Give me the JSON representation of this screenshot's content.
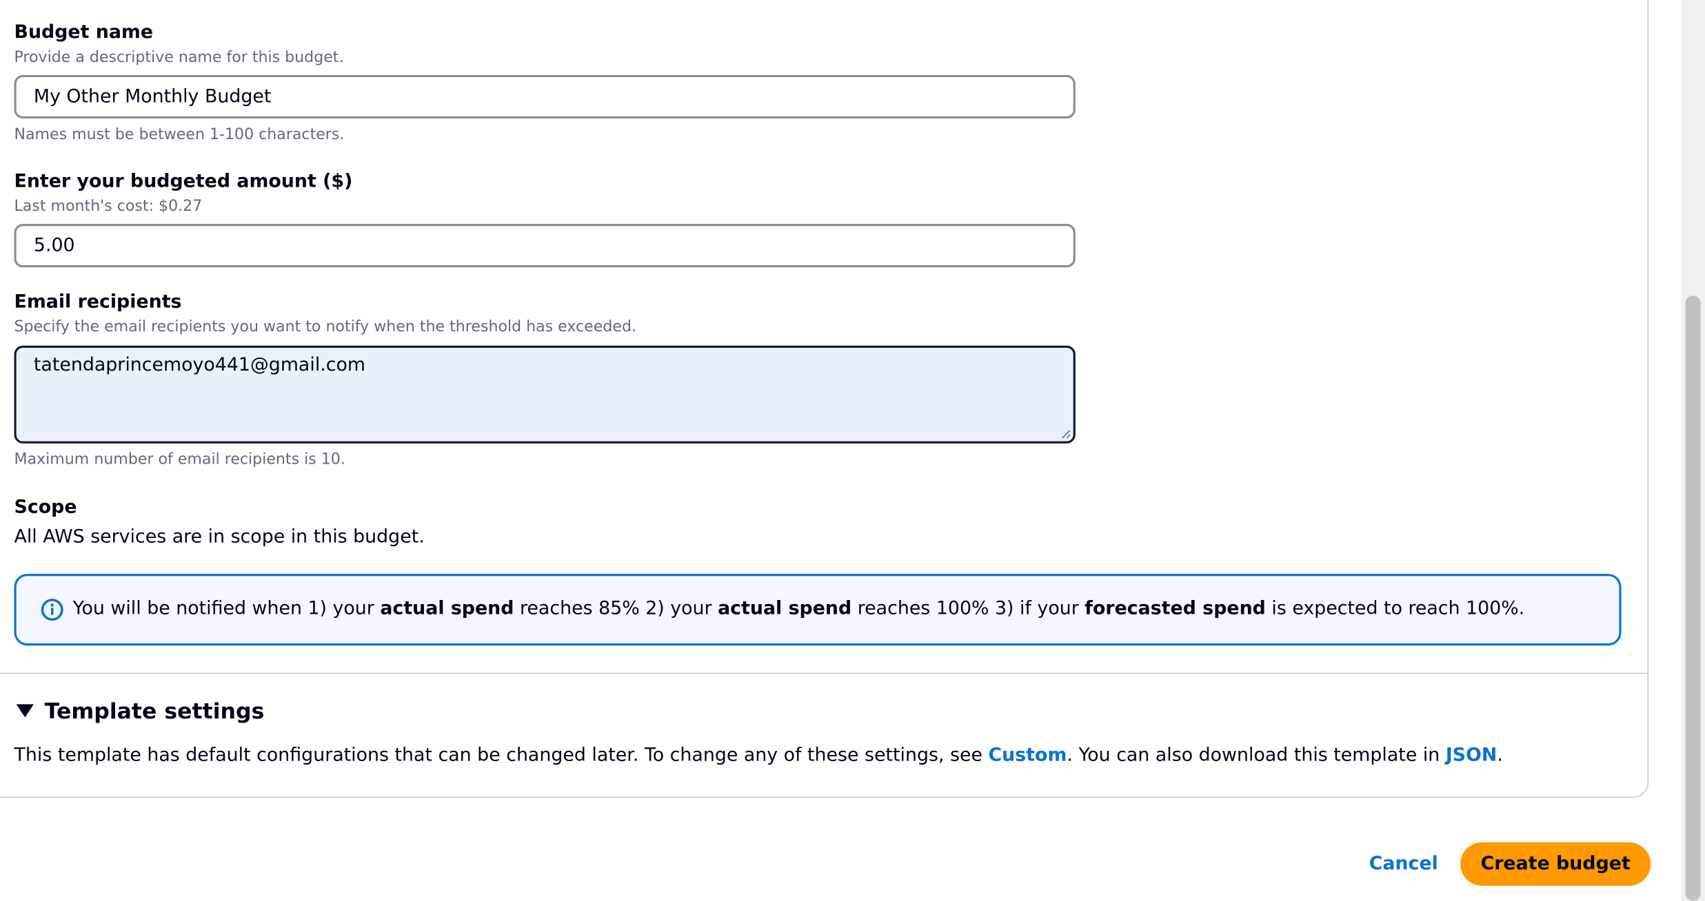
{
  "budget_name": {
    "label": "Budget name",
    "description": "Provide a descriptive name for this budget.",
    "value": "My Other Monthly Budget",
    "constraint": "Names must be between 1-100 characters."
  },
  "budget_amount": {
    "label": "Enter your budgeted amount ($)",
    "description": "Last month's cost: $0.27",
    "value": "5.00"
  },
  "email_recipients": {
    "label": "Email recipients",
    "description": "Specify the email recipients you want to notify when the threshold has exceeded.",
    "value": "tatendaprincemoyo441@gmail.com",
    "constraint": "Maximum number of email recipients is 10."
  },
  "scope": {
    "label": "Scope",
    "text": "All AWS services are in scope in this budget."
  },
  "alert": {
    "icon": "info-icon",
    "part1": "You will be notified when 1) your ",
    "bold1": "actual spend",
    "part2": " reaches 85% 2) your ",
    "bold2": "actual spend",
    "part3": " reaches 100% 3) if your ",
    "bold3": "forecasted spend",
    "part4": " is expected to reach 100%."
  },
  "template_settings": {
    "title": "Template settings",
    "text1": "This template has default configurations that can be changed later. To change any of these settings, see ",
    "link_custom": "Custom",
    "text2": ". You can also download this template in ",
    "link_json": "JSON",
    "text3": "."
  },
  "actions": {
    "cancel": "Cancel",
    "create": "Create budget"
  },
  "colors": {
    "primary_button": "#ff9900",
    "link": "#0972d3",
    "info_border": "#0972d3",
    "info_background": "#f2f8fd",
    "focused_textarea_background": "#e9f0fc"
  }
}
